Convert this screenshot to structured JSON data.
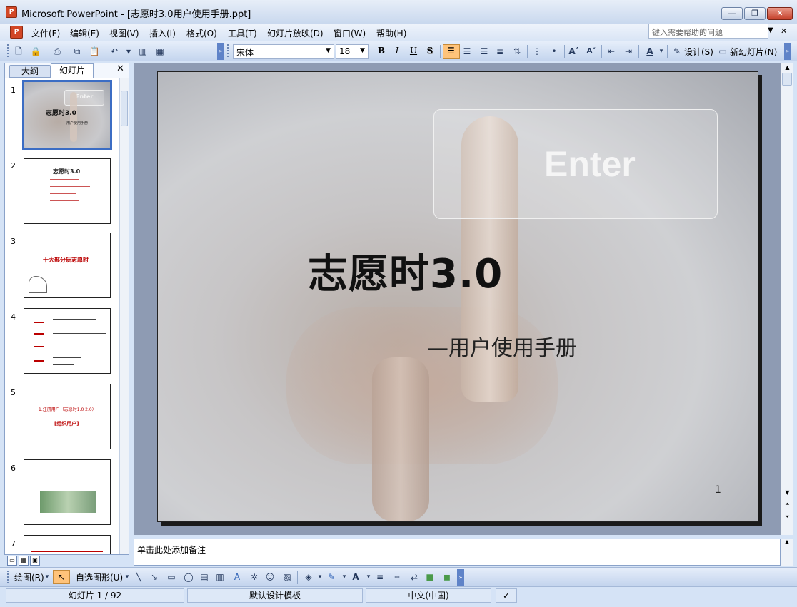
{
  "window": {
    "title": "Microsoft PowerPoint - [志愿时3.0用户使用手册.ppt]",
    "app_icon": "P"
  },
  "menu": {
    "items": [
      "文件(F)",
      "编辑(E)",
      "视图(V)",
      "插入(I)",
      "格式(O)",
      "工具(T)",
      "幻灯片放映(D)",
      "窗口(W)",
      "帮助(H)"
    ],
    "help_placeholder": "键入需要帮助的问题"
  },
  "toolbar": {
    "font_name": "宋体",
    "font_size": "18",
    "bold": "B",
    "italic": "I",
    "underline": "U",
    "shadow": "S",
    "font_color": "A",
    "design_label": "设计(S)",
    "new_slide_label": "新幻灯片(N)"
  },
  "left_panel": {
    "tab_outline": "大纲",
    "tab_slides": "幻灯片",
    "thumbnails": [
      {
        "num": "1",
        "title": "志愿时3.0",
        "subtitle": "—用户使用手册",
        "button": "Enter"
      },
      {
        "num": "2",
        "title": "志愿时3.0"
      },
      {
        "num": "3",
        "title": "十大部分玩志愿时"
      },
      {
        "num": "4"
      },
      {
        "num": "5",
        "line1": "1.注册用户（志愿时1.0 2.0）",
        "line2": "[组织用户]"
      },
      {
        "num": "6"
      },
      {
        "num": "7"
      }
    ]
  },
  "slide": {
    "button_text": "Enter",
    "title": "志愿时3.0",
    "subtitle": "—用户使用手册",
    "number": "1"
  },
  "notes": {
    "placeholder": "单击此处添加备注"
  },
  "drawbar": {
    "draw_label": "绘图(R)",
    "autoshapes_label": "自选图形(U)"
  },
  "status": {
    "slide_info": "幻灯片 1 / 92",
    "template": "默认设计模板",
    "language": "中文(中国)"
  },
  "colors": {
    "accent": "#3b6dc4",
    "highlight": "#ffc37a",
    "powerpoint_red": "#d24726"
  }
}
